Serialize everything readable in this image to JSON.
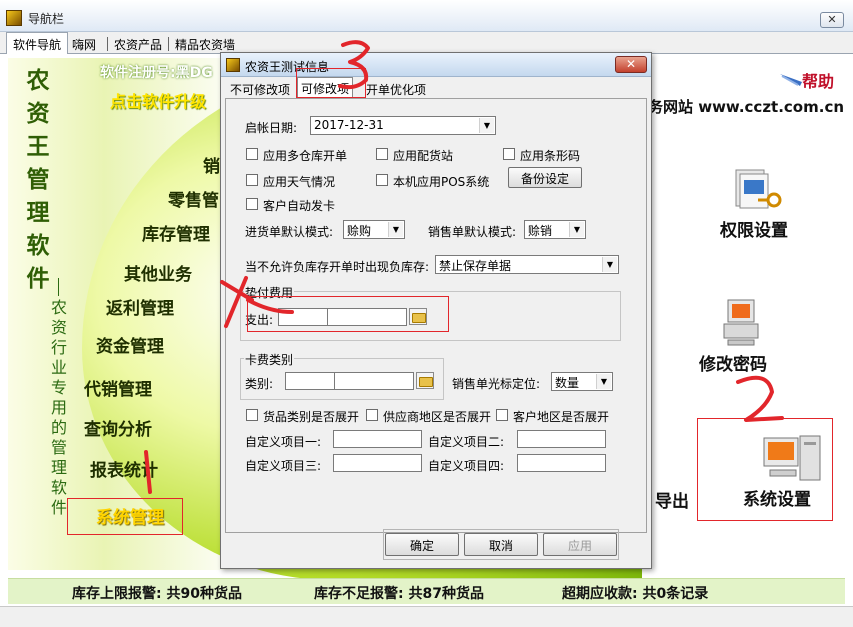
{
  "window": {
    "title": "导航栏",
    "close_label": "✕"
  },
  "nav_tabs": [
    "软件导航",
    "嗨网",
    "农资产品",
    "精品农资墙"
  ],
  "left_panel": {
    "vertical_title": [
      "农",
      "资",
      "王",
      "管",
      "理",
      "软",
      "件"
    ],
    "vertical_subtitle": [
      "农",
      "资",
      "行",
      "业",
      "专",
      "用",
      "的",
      "管",
      "理",
      "软",
      "件"
    ],
    "register_text": "软件注册号:黑DG",
    "click_text": "点击软件升级",
    "menu": {
      "item1": "销",
      "item2": "零售管",
      "item3": "库存管理",
      "item4": "其他业务",
      "item5": "返利管理",
      "item6": "资金管理",
      "item7": "代销管理",
      "item8": "查询分析",
      "item9": "报表统计",
      "item10": "系统管理"
    }
  },
  "right_panel": {
    "help": "帮助",
    "website": "务网站 www.cczt.com.cn",
    "permissions": "权限设置",
    "change_password": "修改密码",
    "export": "导出",
    "system_settings": "系统设置"
  },
  "bottom_bar": {
    "stock_upper": "库存上限报警: 共90种货品",
    "stock_lower": "库存不足报警: 共87种货品",
    "overdue": "超期应收款: 共0条记录"
  },
  "dialog": {
    "title": "农资王测试信息",
    "close_label": "✕",
    "tabs": [
      "不可修改项",
      "可修改项",
      "开单优化项"
    ],
    "start_date_label": "启帐日期:",
    "start_date_value": "2017-12-31",
    "checks": {
      "multi_warehouse": "应用多仓库开单",
      "distribution": "应用配货站",
      "barcode": "应用条形码",
      "weather": "应用天气情况",
      "pos": "本机应用POS系统",
      "auto_card": "客户自动发卡"
    },
    "backup_button": "备份设定",
    "purchase_mode_label": "进货单默认模式:",
    "purchase_mode_value": "赊购",
    "sales_mode_label": "销售单默认模式:",
    "sales_mode_value": "赊销",
    "negative_stock_label": "当不允许负库存开单时出现负库存:",
    "negative_stock_value": "禁止保存单据",
    "advance_group": "垫付费用",
    "expense_label": "支出:",
    "card_group": "卡费类别",
    "category_label": "类别:",
    "cursor_label": "销售单光标定位:",
    "cursor_value": "数量",
    "expand": {
      "goods": "货品类别是否展开",
      "supplier": "供应商地区是否展开",
      "customer": "客户地区是否展开"
    },
    "custom": {
      "c1": "自定义项目一:",
      "c2": "自定义项目二:",
      "c3": "自定义项目三:",
      "c4": "自定义项目四:"
    },
    "buttons": {
      "ok": "确定",
      "cancel": "取消",
      "apply": "应用"
    }
  }
}
